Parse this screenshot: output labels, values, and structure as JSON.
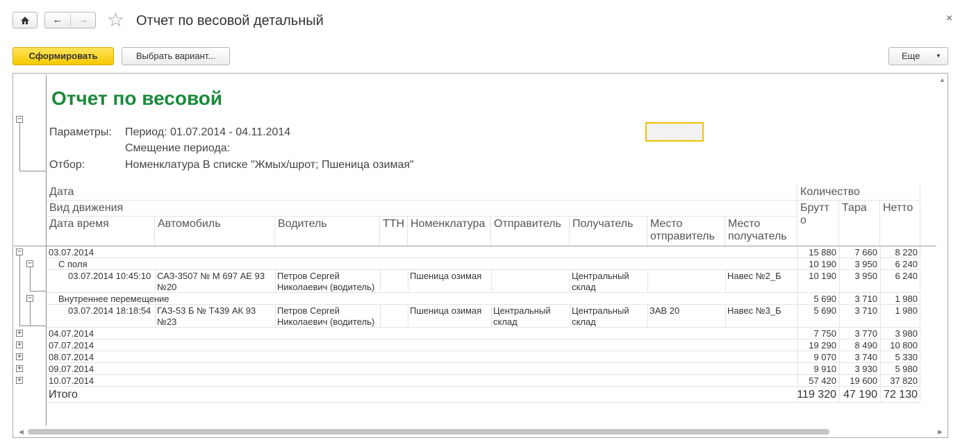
{
  "window": {
    "title": "Отчет по весовой детальный",
    "close": "×"
  },
  "toolbar": {
    "generate_label": "Сформировать",
    "choose_variant_label": "Выбрать вариант...",
    "more_label": "Еще",
    "more_arrow": "▼"
  },
  "report": {
    "title": "Отчет по весовой",
    "params_label": "Параметры:",
    "period": "Период: 01.07.2014 - 04.11.2014",
    "period_shift": "Смещение периода:",
    "filter_label": "Отбор:",
    "filter_value": "Номенклатура В списке \"Жмых/шрот; Пшеница озимая\""
  },
  "headers": {
    "date": "Дата",
    "movement": "Вид движения",
    "datetime": "Дата время",
    "car": "Автомобиль",
    "driver": "Водитель",
    "ttn": "ТТН",
    "nomenclature": "Номенклатура",
    "sender": "Отправитель",
    "receiver": "Получатель",
    "sender_place_1": "Место",
    "sender_place_2": "отправитель",
    "receiver_place_1": "Место",
    "receiver_place_2": "получатель",
    "quantity": "Количество",
    "gross_1": "Брутт",
    "gross_2": "о",
    "tare": "Тара",
    "net": "Нетто"
  },
  "rows": {
    "d1": {
      "date": "03.07.2014",
      "gross": "15 880",
      "tare": "7 660",
      "net": "8 220"
    },
    "g1": {
      "name": "С поля",
      "gross": "10 190",
      "tare": "3 950",
      "net": "6 240"
    },
    "r1": {
      "datetime": "03.07.2014 10:45:10",
      "car_1": "САЗ-3507 № М 697 АЕ 93",
      "car_2": "№20",
      "driver_1": "Петров Сергей",
      "driver_2": "Николаевич (водитель)",
      "nomenclature": "Пшеница озимая",
      "sender_1": "",
      "sender_2": "",
      "receiver_1": "Центральный",
      "receiver_2": "склад",
      "sender_place": "",
      "receiver_place": "Навес №2_Б",
      "gross": "10 190",
      "tare": "3 950",
      "net": "6 240"
    },
    "g2": {
      "name": "Внутреннее перемещение",
      "gross": "5 690",
      "tare": "3 710",
      "net": "1 980"
    },
    "r2": {
      "datetime": "03.07.2014 18:18:54",
      "car_1": "ГАЗ-53 Б № Т439 АК 93",
      "car_2": "№23",
      "driver_1": "Петров Сергей",
      "driver_2": "Николаевич (водитель)",
      "nomenclature": "Пшеница озимая",
      "sender_1": "Центральный",
      "sender_2": "склад",
      "receiver_1": "Центральный",
      "receiver_2": "склад",
      "sender_place": "ЗАВ 20",
      "receiver_place": "Навес №3_Б",
      "gross": "5 690",
      "tare": "3 710",
      "net": "1 980"
    },
    "d2": {
      "date": "04.07.2014",
      "gross": "7 750",
      "tare": "3 770",
      "net": "3 980"
    },
    "d3": {
      "date": "07.07.2014",
      "gross": "19 290",
      "tare": "8 490",
      "net": "10 800"
    },
    "d4": {
      "date": "08.07.2014",
      "gross": "9 070",
      "tare": "3 740",
      "net": "5 330"
    },
    "d5": {
      "date": "09.07.2014",
      "gross": "9 910",
      "tare": "3 930",
      "net": "5 980"
    },
    "d6": {
      "date": "10.07.2014",
      "gross": "57 420",
      "tare": "19 600",
      "net": "37 820"
    },
    "total": {
      "label": "Итого",
      "gross": "119 320",
      "tare": "47 190",
      "net": "72 130"
    }
  },
  "tree": {
    "minus": "−",
    "plus": "+"
  }
}
